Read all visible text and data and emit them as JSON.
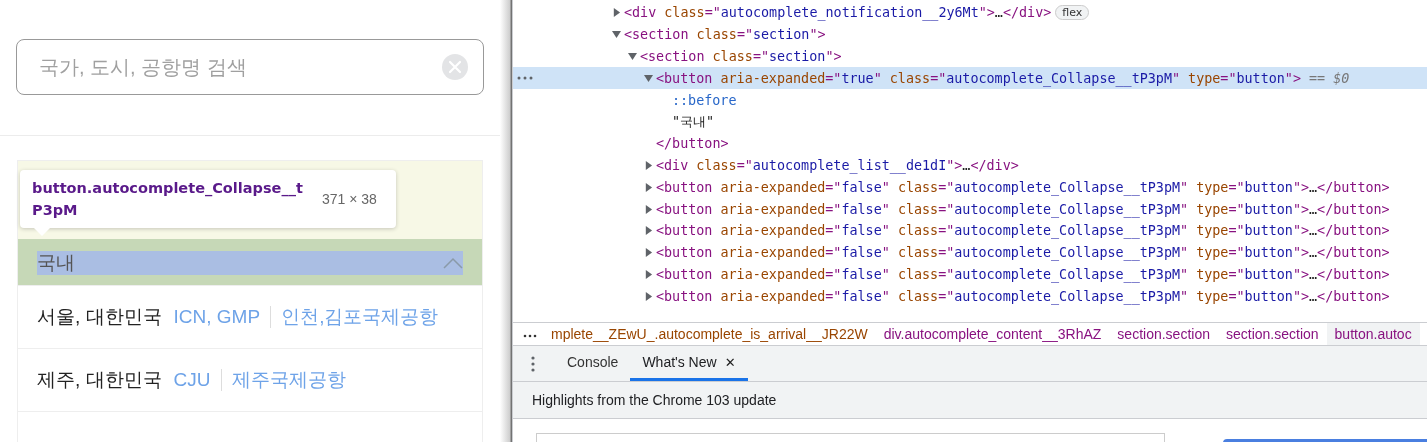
{
  "page": {
    "search": {
      "placeholder": "국가, 도시, 공항명 검색"
    },
    "inspect_tooltip": {
      "selector": "button.autocomplete_Collapse__tP3pM",
      "size": "371 × 38"
    },
    "section": {
      "label": "국내",
      "expanded": true
    },
    "results": [
      {
        "city": "서울, 대한민국",
        "codes": "ICN, GMP",
        "airports": "인천,김포국제공항"
      },
      {
        "city": "제주, 대한민국",
        "codes": "CJU",
        "airports": "제주국제공항"
      }
    ]
  },
  "devtools": {
    "dom_tree": [
      {
        "expanded": false,
        "selected": false,
        "tokens": [
          {
            "kind": "tag",
            "text": "<div "
          },
          {
            "kind": "attr",
            "text": "class"
          },
          {
            "kind": "tag",
            "text": "=\""
          },
          {
            "kind": "value",
            "text": "autocomplete_notification__2y6Mt"
          },
          {
            "kind": "tag",
            "text": "\">"
          },
          {
            "kind": "plain",
            "text": "…"
          },
          {
            "kind": "tag",
            "text": "</div>"
          },
          {
            "kind": "badge",
            "text": "flex"
          }
        ]
      },
      {
        "expanded": true,
        "selected": false,
        "tokens": [
          {
            "kind": "tag",
            "text": "<section "
          },
          {
            "kind": "attr",
            "text": "class"
          },
          {
            "kind": "tag",
            "text": "=\""
          },
          {
            "kind": "value",
            "text": "section"
          },
          {
            "kind": "tag",
            "text": "\">"
          }
        ],
        "children": [
          {
            "expanded": true,
            "selected": false,
            "tokens": [
              {
                "kind": "tag",
                "text": "<section "
              },
              {
                "kind": "attr",
                "text": "class"
              },
              {
                "kind": "tag",
                "text": "=\""
              },
              {
                "kind": "value",
                "text": "section"
              },
              {
                "kind": "tag",
                "text": "\">"
              }
            ],
            "children": [
              {
                "expanded": true,
                "selected": true,
                "tokens": [
                  {
                    "kind": "tag",
                    "text": "<button "
                  },
                  {
                    "kind": "attr",
                    "text": "aria-expanded"
                  },
                  {
                    "kind": "tag",
                    "text": "=\""
                  },
                  {
                    "kind": "value",
                    "text": "true"
                  },
                  {
                    "kind": "tag",
                    "text": "\" "
                  },
                  {
                    "kind": "attr",
                    "text": "class"
                  },
                  {
                    "kind": "tag",
                    "text": "=\""
                  },
                  {
                    "kind": "value",
                    "text": "autocomplete_Collapse__tP3pM"
                  },
                  {
                    "kind": "tag",
                    "text": "\" "
                  },
                  {
                    "kind": "attr",
                    "text": "type"
                  },
                  {
                    "kind": "tag",
                    "text": "=\""
                  },
                  {
                    "kind": "value",
                    "text": "button"
                  },
                  {
                    "kind": "tag",
                    "text": "\">"
                  },
                  {
                    "kind": "ref",
                    "text": "== $0"
                  }
                ],
                "closing": "</button>",
                "children": [
                  {
                    "selected": false,
                    "tokens": [
                      {
                        "kind": "pseudo",
                        "text": "::before"
                      }
                    ]
                  },
                  {
                    "selected": false,
                    "tokens": [
                      {
                        "kind": "plain",
                        "text": "\"국내\""
                      }
                    ]
                  }
                ]
              },
              {
                "expanded": false,
                "selected": false,
                "tokens": [
                  {
                    "kind": "tag",
                    "text": "<div "
                  },
                  {
                    "kind": "attr",
                    "text": "class"
                  },
                  {
                    "kind": "tag",
                    "text": "=\""
                  },
                  {
                    "kind": "value",
                    "text": "autocomplete_list__de1dI"
                  },
                  {
                    "kind": "tag",
                    "text": "\">"
                  },
                  {
                    "kind": "plain",
                    "text": "…"
                  },
                  {
                    "kind": "tag",
                    "text": "</div>"
                  }
                ]
              },
              {
                "expanded": false,
                "selected": false,
                "tokens": [
                  {
                    "kind": "tag",
                    "text": "<button "
                  },
                  {
                    "kind": "attr",
                    "text": "aria-expanded"
                  },
                  {
                    "kind": "tag",
                    "text": "=\""
                  },
                  {
                    "kind": "value",
                    "text": "false"
                  },
                  {
                    "kind": "tag",
                    "text": "\" "
                  },
                  {
                    "kind": "attr",
                    "text": "class"
                  },
                  {
                    "kind": "tag",
                    "text": "=\""
                  },
                  {
                    "kind": "value",
                    "text": "autocomplete_Collapse__tP3pM"
                  },
                  {
                    "kind": "tag",
                    "text": "\" "
                  },
                  {
                    "kind": "attr",
                    "text": "type"
                  },
                  {
                    "kind": "tag",
                    "text": "=\""
                  },
                  {
                    "kind": "value",
                    "text": "button"
                  },
                  {
                    "kind": "tag",
                    "text": "\">"
                  },
                  {
                    "kind": "plain",
                    "text": "…"
                  },
                  {
                    "kind": "tag",
                    "text": "</button>"
                  }
                ]
              },
              {
                "expanded": false,
                "selected": false,
                "tokens": [
                  {
                    "kind": "tag",
                    "text": "<button "
                  },
                  {
                    "kind": "attr",
                    "text": "aria-expanded"
                  },
                  {
                    "kind": "tag",
                    "text": "=\""
                  },
                  {
                    "kind": "value",
                    "text": "false"
                  },
                  {
                    "kind": "tag",
                    "text": "\" "
                  },
                  {
                    "kind": "attr",
                    "text": "class"
                  },
                  {
                    "kind": "tag",
                    "text": "=\""
                  },
                  {
                    "kind": "value",
                    "text": "autocomplete_Collapse__tP3pM"
                  },
                  {
                    "kind": "tag",
                    "text": "\" "
                  },
                  {
                    "kind": "attr",
                    "text": "type"
                  },
                  {
                    "kind": "tag",
                    "text": "=\""
                  },
                  {
                    "kind": "value",
                    "text": "button"
                  },
                  {
                    "kind": "tag",
                    "text": "\">"
                  },
                  {
                    "kind": "plain",
                    "text": "…"
                  },
                  {
                    "kind": "tag",
                    "text": "</button>"
                  }
                ]
              },
              {
                "expanded": false,
                "selected": false,
                "tokens": [
                  {
                    "kind": "tag",
                    "text": "<button "
                  },
                  {
                    "kind": "attr",
                    "text": "aria-expanded"
                  },
                  {
                    "kind": "tag",
                    "text": "=\""
                  },
                  {
                    "kind": "value",
                    "text": "false"
                  },
                  {
                    "kind": "tag",
                    "text": "\" "
                  },
                  {
                    "kind": "attr",
                    "text": "class"
                  },
                  {
                    "kind": "tag",
                    "text": "=\""
                  },
                  {
                    "kind": "value",
                    "text": "autocomplete_Collapse__tP3pM"
                  },
                  {
                    "kind": "tag",
                    "text": "\" "
                  },
                  {
                    "kind": "attr",
                    "text": "type"
                  },
                  {
                    "kind": "tag",
                    "text": "=\""
                  },
                  {
                    "kind": "value",
                    "text": "button"
                  },
                  {
                    "kind": "tag",
                    "text": "\">"
                  },
                  {
                    "kind": "plain",
                    "text": "…"
                  },
                  {
                    "kind": "tag",
                    "text": "</button>"
                  }
                ]
              },
              {
                "expanded": false,
                "selected": false,
                "tokens": [
                  {
                    "kind": "tag",
                    "text": "<button "
                  },
                  {
                    "kind": "attr",
                    "text": "aria-expanded"
                  },
                  {
                    "kind": "tag",
                    "text": "=\""
                  },
                  {
                    "kind": "value",
                    "text": "false"
                  },
                  {
                    "kind": "tag",
                    "text": "\" "
                  },
                  {
                    "kind": "attr",
                    "text": "class"
                  },
                  {
                    "kind": "tag",
                    "text": "=\""
                  },
                  {
                    "kind": "value",
                    "text": "autocomplete_Collapse__tP3pM"
                  },
                  {
                    "kind": "tag",
                    "text": "\" "
                  },
                  {
                    "kind": "attr",
                    "text": "type"
                  },
                  {
                    "kind": "tag",
                    "text": "=\""
                  },
                  {
                    "kind": "value",
                    "text": "button"
                  },
                  {
                    "kind": "tag",
                    "text": "\">"
                  },
                  {
                    "kind": "plain",
                    "text": "…"
                  },
                  {
                    "kind": "tag",
                    "text": "</button>"
                  }
                ]
              },
              {
                "expanded": false,
                "selected": false,
                "tokens": [
                  {
                    "kind": "tag",
                    "text": "<button "
                  },
                  {
                    "kind": "attr",
                    "text": "aria-expanded"
                  },
                  {
                    "kind": "tag",
                    "text": "=\""
                  },
                  {
                    "kind": "value",
                    "text": "false"
                  },
                  {
                    "kind": "tag",
                    "text": "\" "
                  },
                  {
                    "kind": "attr",
                    "text": "class"
                  },
                  {
                    "kind": "tag",
                    "text": "=\""
                  },
                  {
                    "kind": "value",
                    "text": "autocomplete_Collapse__tP3pM"
                  },
                  {
                    "kind": "tag",
                    "text": "\" "
                  },
                  {
                    "kind": "attr",
                    "text": "type"
                  },
                  {
                    "kind": "tag",
                    "text": "=\""
                  },
                  {
                    "kind": "value",
                    "text": "button"
                  },
                  {
                    "kind": "tag",
                    "text": "\">"
                  },
                  {
                    "kind": "plain",
                    "text": "…"
                  },
                  {
                    "kind": "tag",
                    "text": "</button>"
                  }
                ]
              },
              {
                "expanded": false,
                "selected": false,
                "tokens": [
                  {
                    "kind": "tag",
                    "text": "<button "
                  },
                  {
                    "kind": "attr",
                    "text": "aria-expanded"
                  },
                  {
                    "kind": "tag",
                    "text": "=\""
                  },
                  {
                    "kind": "value",
                    "text": "false"
                  },
                  {
                    "kind": "tag",
                    "text": "\" "
                  },
                  {
                    "kind": "attr",
                    "text": "class"
                  },
                  {
                    "kind": "tag",
                    "text": "=\""
                  },
                  {
                    "kind": "value",
                    "text": "autocomplete_Collapse__tP3pM"
                  },
                  {
                    "kind": "tag",
                    "text": "\" "
                  },
                  {
                    "kind": "attr",
                    "text": "type"
                  },
                  {
                    "kind": "tag",
                    "text": "=\""
                  },
                  {
                    "kind": "value",
                    "text": "button"
                  },
                  {
                    "kind": "tag",
                    "text": "\">"
                  },
                  {
                    "kind": "plain",
                    "text": "…"
                  },
                  {
                    "kind": "tag",
                    "text": "</button>"
                  }
                ]
              }
            ]
          }
        ]
      }
    ],
    "breadcrumbs": [
      {
        "text": "mplete__ZEwU_.autocomplete_is_arrival__JR22W",
        "selected": false
      },
      {
        "text": "div.autocomplete_content__3RhAZ",
        "selected": false
      },
      {
        "text": "section.section",
        "selected": false
      },
      {
        "text": "section.section",
        "selected": false
      },
      {
        "text": "button.autoc",
        "selected": true
      }
    ],
    "drawer_tabs": [
      {
        "label": "Console",
        "selected": false,
        "closable": false
      },
      {
        "label": "What's New",
        "selected": true,
        "closable": true
      }
    ],
    "close_glyph": "✕",
    "whats_new": {
      "headline": "Highlights from the Chrome 103 update"
    }
  }
}
